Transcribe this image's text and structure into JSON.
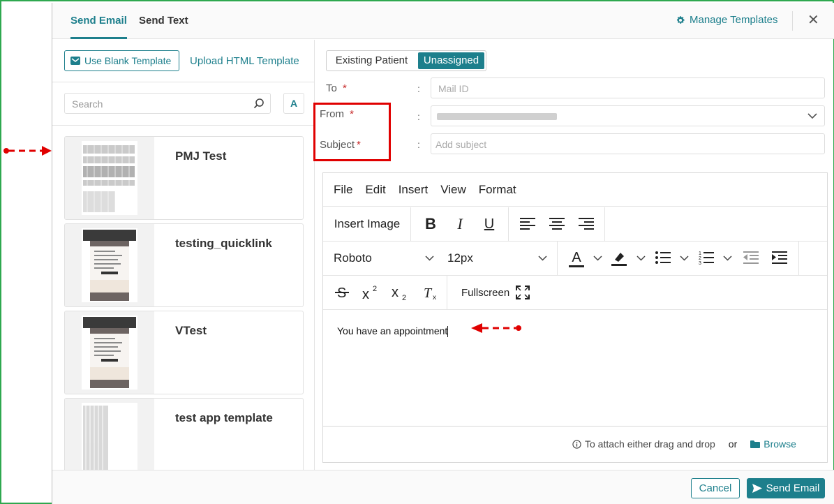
{
  "tabs": [
    {
      "label": "Send Email",
      "active": true
    },
    {
      "label": "Send Text",
      "active": false
    }
  ],
  "header": {
    "manage_templates": "Manage Templates"
  },
  "left": {
    "blank_template": "Use Blank Template",
    "upload_html": "Upload HTML Template",
    "search_placeholder": "Search",
    "sort_label": "A",
    "templates": [
      {
        "title": "PMJ Test"
      },
      {
        "title": "testing_quicklink"
      },
      {
        "title": "VTest"
      },
      {
        "title": "test app template"
      }
    ]
  },
  "form": {
    "toggle": {
      "option_a": "Existing Patient",
      "option_b": "Unassigned",
      "selected": "Unassigned"
    },
    "to_label": "To",
    "from_label": "From",
    "subject_label": "Subject",
    "required_mark": "*",
    "colon": ":",
    "to_placeholder": "Mail ID",
    "subject_placeholder": "Add subject"
  },
  "editor": {
    "menu": [
      "File",
      "Edit",
      "Insert",
      "View",
      "Format"
    ],
    "insert_image": "Insert Image",
    "bold": "B",
    "italic": "I",
    "underline": "U",
    "font_family": "Roboto",
    "font_size": "12px",
    "text_color_glyph": "A",
    "fullscreen": "Fullscreen",
    "content": "You have an appointment"
  },
  "attach": {
    "hint": "To attach either drag and drop",
    "or": "or",
    "browse": "Browse"
  },
  "footer": {
    "cancel": "Cancel",
    "send": "Send Email"
  },
  "colors": {
    "accent": "#1d7f8c",
    "annotation": "#e00000",
    "frame": "#2ea84f"
  }
}
